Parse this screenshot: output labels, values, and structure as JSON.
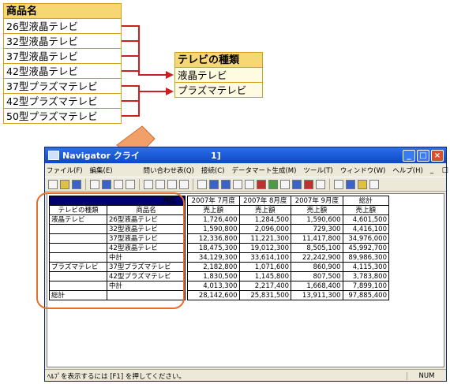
{
  "product_table": {
    "header": "商品名",
    "items": [
      "26型液晶テレビ",
      "32型液晶テレビ",
      "37型液晶テレビ",
      "42型液晶テレビ",
      "37型プラズマテレビ",
      "42型プラズマテレビ",
      "50型プラズマテレビ"
    ]
  },
  "type_table": {
    "header": "テレビの種類",
    "items": [
      "液晶テレビ",
      "プラズマテレビ"
    ]
  },
  "window": {
    "title": "Navigator クライ",
    "title_suffix": "1]",
    "menu": [
      "ファイル(F)",
      "編集(E)",
      "問い合わせ表(Q)",
      "接続(C)",
      "データマート生成(M)",
      "ツール(T)",
      "ウィンドウ(W)",
      "ヘルプ(H)"
    ],
    "mdi_controls": "_ □ ×",
    "status_text": "ﾍﾙﾌﾟを表示するには [F1] を押してください。",
    "status_num": "NUM",
    "colors": {
      "title": "#0a48c8",
      "highlight": "#e56f2a",
      "cell_border": "#d4a017",
      "header_fill": "#f7d774"
    }
  },
  "grid": {
    "month_label": "月度",
    "headers": [
      "2007年 7月度",
      "2007年 8月度",
      "2007年 9月度",
      "総計"
    ],
    "subheaders": [
      "売上額",
      "売上額",
      "売上額",
      "売上額"
    ],
    "dim_headers": [
      "テレビの種類",
      "商品名"
    ],
    "rows": [
      {
        "type": "液晶テレビ",
        "name": "26型液晶テレビ",
        "v": [
          "1,726,400",
          "1,284,500",
          "1,590,600",
          "4,601,500"
        ]
      },
      {
        "type": "",
        "name": "32型液晶テレビ",
        "v": [
          "1,590,800",
          "2,096,000",
          "729,300",
          "4,416,100"
        ]
      },
      {
        "type": "",
        "name": "37型液晶テレビ",
        "v": [
          "12,336,800",
          "11,221,300",
          "11,417,800",
          "34,976,000"
        ]
      },
      {
        "type": "",
        "name": "42型液晶テレビ",
        "v": [
          "18,475,300",
          "19,012,300",
          "8,505,100",
          "45,992,700"
        ]
      },
      {
        "type": "",
        "name": "中計",
        "v": [
          "34,129,300",
          "33,614,100",
          "22,242,900",
          "89,986,300"
        ]
      },
      {
        "type": "プラズマテレビ",
        "name": "37型プラズマテレビ",
        "v": [
          "2,182,800",
          "1,071,600",
          "860,900",
          "4,115,300"
        ]
      },
      {
        "type": "",
        "name": "42型プラズマテレビ",
        "v": [
          "1,830,500",
          "1,145,800",
          "807,500",
          "3,783,800"
        ]
      },
      {
        "type": "",
        "name": "中計",
        "v": [
          "4,013,300",
          "2,217,400",
          "1,668,400",
          "7,899,100"
        ]
      },
      {
        "type": "総計",
        "name": "",
        "v": [
          "28,142,600",
          "25,831,500",
          "13,911,300",
          "97,885,400"
        ]
      }
    ]
  }
}
